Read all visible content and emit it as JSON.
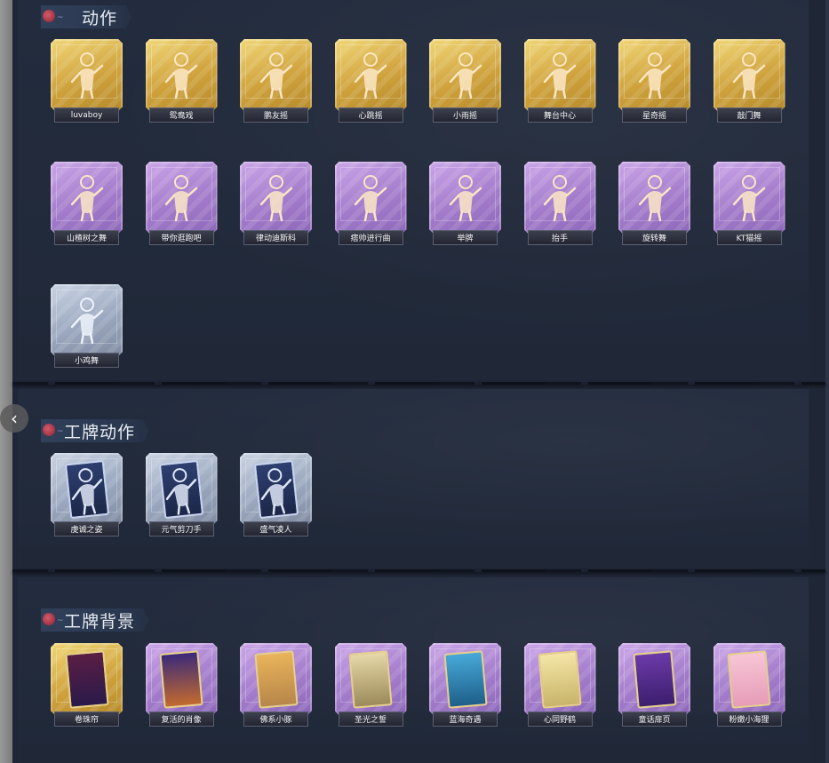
{
  "sections": [
    {
      "title": "动作",
      "items": [
        {
          "label": "luvaboy",
          "rarity": "gold"
        },
        {
          "label": "鸳鸯戏",
          "rarity": "gold"
        },
        {
          "label": "鹏友摇",
          "rarity": "gold"
        },
        {
          "label": "心跳摇",
          "rarity": "gold"
        },
        {
          "label": "小雨摇",
          "rarity": "gold"
        },
        {
          "label": "舞台中心",
          "rarity": "gold"
        },
        {
          "label": "星奇摇",
          "rarity": "gold"
        },
        {
          "label": "敲门舞",
          "rarity": "gold"
        },
        {
          "label": "山楂树之舞",
          "rarity": "purple"
        },
        {
          "label": "带你逛跑吧",
          "rarity": "purple"
        },
        {
          "label": "律动迪斯科",
          "rarity": "purple"
        },
        {
          "label": "痞帅进行曲",
          "rarity": "purple"
        },
        {
          "label": "举牌",
          "rarity": "purple"
        },
        {
          "label": "抬手",
          "rarity": "purple"
        },
        {
          "label": "旋转舞",
          "rarity": "purple"
        },
        {
          "label": "KT猫摇",
          "rarity": "purple"
        },
        {
          "label": "小鸡舞",
          "rarity": "silver"
        }
      ]
    },
    {
      "title": "工牌动作",
      "items": [
        {
          "label": "虔诚之姿",
          "rarity": "silver"
        },
        {
          "label": "元气剪刀手",
          "rarity": "silver"
        },
        {
          "label": "盛气凌人",
          "rarity": "silver"
        }
      ]
    },
    {
      "title": "工牌背景",
      "items": [
        {
          "label": "卷珠帘",
          "rarity": "gold"
        },
        {
          "label": "复活的肖像",
          "rarity": "purple"
        },
        {
          "label": "佛系小豚",
          "rarity": "purple"
        },
        {
          "label": "圣光之誓",
          "rarity": "purple"
        },
        {
          "label": "蓝海奇遇",
          "rarity": "purple"
        },
        {
          "label": "心同野鹤",
          "rarity": "purple"
        },
        {
          "label": "童话扉页",
          "rarity": "purple"
        },
        {
          "label": "粉嫩小海狸",
          "rarity": "purple"
        }
      ]
    }
  ],
  "nav": {
    "back_icon": "chevron-left-icon",
    "back_glyph": "‹"
  },
  "colors": {
    "gold": "#d9b24a",
    "purple": "#a37ccb",
    "silver": "#9aa7be",
    "board": "#1f2636"
  }
}
